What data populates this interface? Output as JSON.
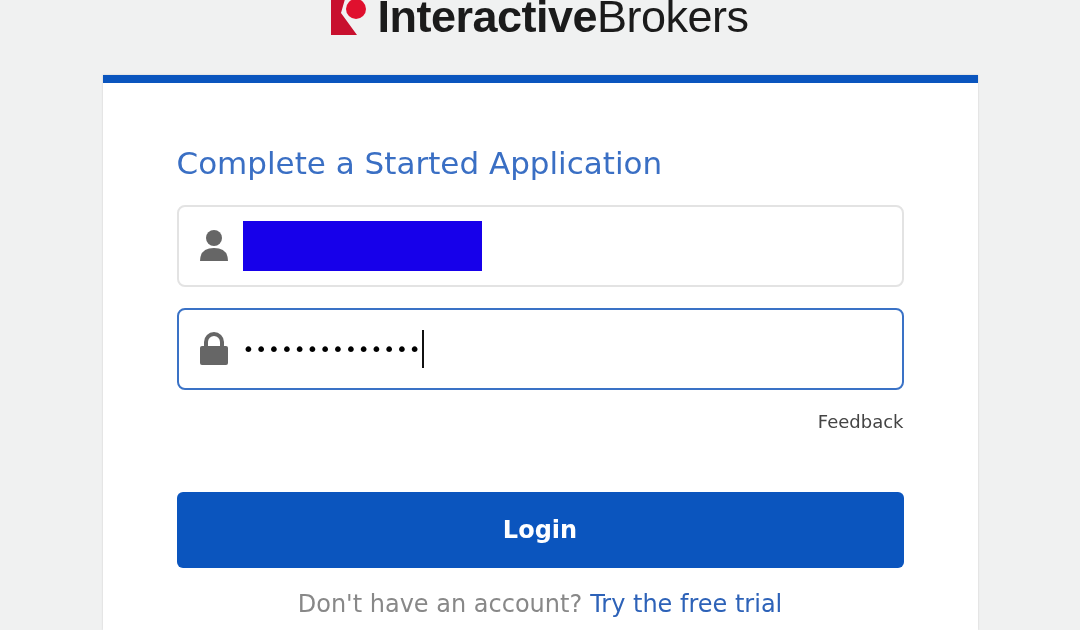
{
  "logo": {
    "text": "**Interactive**Brokers"
  },
  "heading": "Complete a Started Application",
  "username_field": {
    "redacted": true,
    "focused": false
  },
  "password_field": {
    "value": "••••••••••••••",
    "focused": true
  },
  "feedback_link": "Feedback",
  "login_button": "Login",
  "signup": {
    "prompt": "Don't have an account?",
    "link": "Try the free trial"
  }
}
